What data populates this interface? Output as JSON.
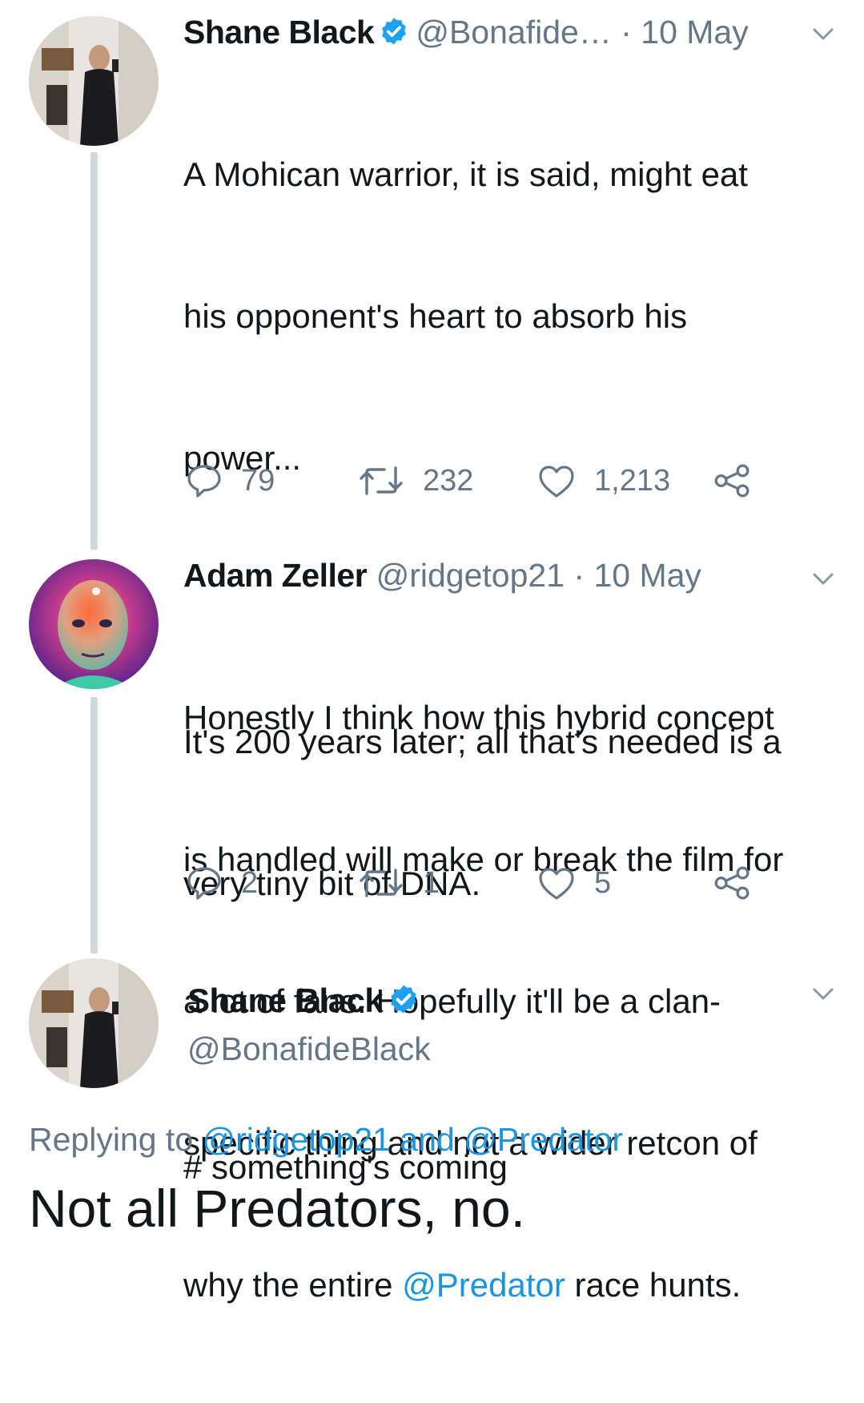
{
  "tweets": [
    {
      "name": "Shane Black",
      "handle": "@Bonafide…",
      "time": "· 10 May",
      "verified": true,
      "lines": [
        "A Mohican warrior, it is said, might eat",
        "his opponent's heart to absorb his",
        "power...",
        "",
        "It's 200 years later; all that's needed is a",
        "very tiny bit of DNA.",
        "",
        "# something's coming"
      ],
      "reply_count": "79",
      "retweet_count": "232",
      "like_count": "1,213"
    },
    {
      "name": "Adam Zeller",
      "handle": "@ridgetop21",
      "time": "· 10 May",
      "verified": false,
      "lines": [
        "Honestly I think how this hybrid concept",
        "is handled will make or break the film for",
        "a lot of fans. Hopefully it'll be a clan-",
        "specific thing and not a wider retcon of"
      ],
      "last_line_prefix": "why the entire ",
      "mention": "@Predator",
      "last_line_suffix": " race hunts.",
      "reply_count": "2",
      "retweet_count": "1",
      "like_count": "5"
    }
  ],
  "focused": {
    "name": "Shane Black",
    "handle": "@BonafideBlack",
    "replying_prefix": "Replying to ",
    "replying_user1": "@ridgetop21",
    "replying_and": " and ",
    "replying_user2": "@Predator",
    "text": "Not all Predators, no."
  },
  "colors": {
    "link": "#1b95e0",
    "verified": "#1da1f2",
    "muted": "#657786",
    "thread_line": "#cfd9de"
  },
  "icons": [
    "reply-icon",
    "retweet-icon",
    "like-icon",
    "share-icon",
    "verified-badge-icon",
    "chevron-down-icon"
  ]
}
